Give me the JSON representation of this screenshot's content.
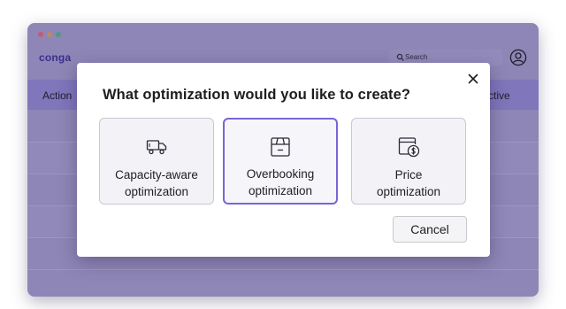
{
  "app": {
    "logo": "conga",
    "search_placeholder": "Search",
    "table_headers": {
      "action": "Action",
      "active": "ctive"
    }
  },
  "modal": {
    "title": "What optimization would you like to create?",
    "options": [
      {
        "label_line1": "Capacity-aware",
        "label_line2": "optimization",
        "icon": "truck-icon",
        "selected": false
      },
      {
        "label_line1": "Overbooking",
        "label_line2": "optimization",
        "icon": "box-icon",
        "selected": true
      },
      {
        "label_line1": "Price",
        "label_line2": "optimization",
        "icon": "price-tag-icon",
        "selected": false
      }
    ],
    "cancel_label": "Cancel"
  },
  "colors": {
    "accent": "#7b63d6",
    "backdrop": "#8e86b6",
    "table_header": "#7f76bb",
    "logo": "#3a2f8e"
  }
}
